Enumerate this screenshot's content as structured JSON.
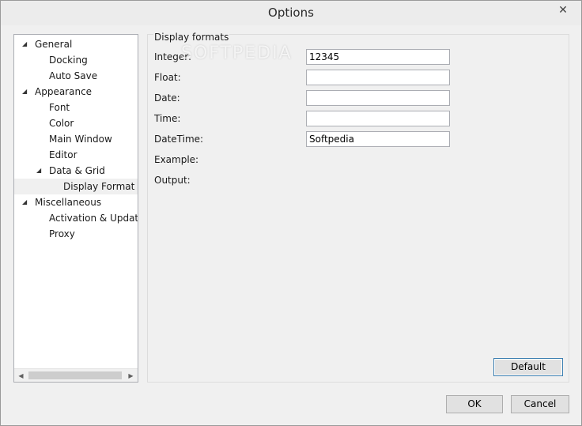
{
  "window": {
    "title": "Options",
    "close_glyph": "✕"
  },
  "tree": {
    "items": [
      {
        "label": "General",
        "level": 0,
        "expanded": true
      },
      {
        "label": "Docking",
        "level": 1
      },
      {
        "label": "Auto Save",
        "level": 1
      },
      {
        "label": "Appearance",
        "level": 0,
        "expanded": true
      },
      {
        "label": "Font",
        "level": 1
      },
      {
        "label": "Color",
        "level": 1
      },
      {
        "label": "Main Window",
        "level": 1
      },
      {
        "label": "Editor",
        "level": 1
      },
      {
        "label": "Data & Grid",
        "level": 1,
        "expanded": true
      },
      {
        "label": "Display Format",
        "level": 2,
        "selected": true
      },
      {
        "label": "Miscellaneous",
        "level": 0,
        "expanded": true
      },
      {
        "label": "Activation & Updates",
        "level": 1
      },
      {
        "label": "Proxy",
        "level": 1
      }
    ],
    "expander_glyph": "◢",
    "scroll_left": "◀",
    "scroll_right": "▶"
  },
  "display_formats": {
    "title": "Display formats",
    "fields": {
      "integer": {
        "label": "Integer:",
        "value": "12345"
      },
      "float": {
        "label": "Float:",
        "value": ""
      },
      "date": {
        "label": "Date:",
        "value": ""
      },
      "time": {
        "label": "Time:",
        "value": ""
      },
      "datetime": {
        "label": "DateTime:",
        "value": "Softpedia"
      }
    },
    "example_label": "Example:",
    "output_label": "Output:",
    "default_button": "Default"
  },
  "footer": {
    "ok_button": "OK",
    "cancel_button": "Cancel"
  },
  "watermark": "SOFTPEDIA"
}
